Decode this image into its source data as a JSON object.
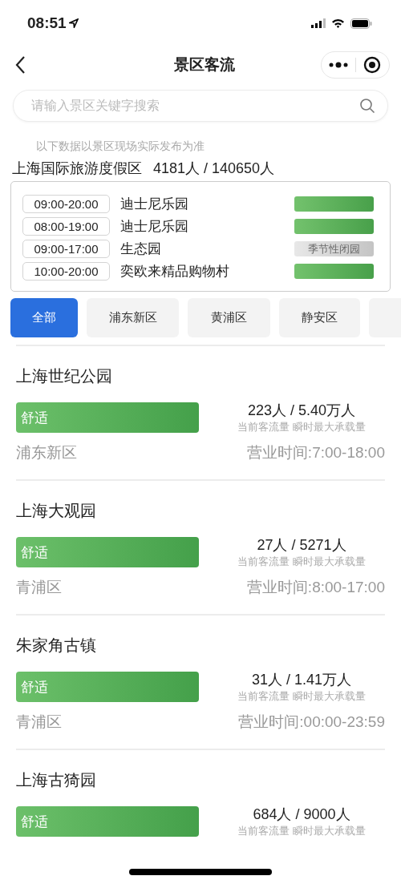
{
  "status_bar": {
    "time": "08:51"
  },
  "nav": {
    "title": "景区客流"
  },
  "search": {
    "placeholder": "请输入景区关键字搜索"
  },
  "notice": "以下数据以景区现场实际发布为准",
  "resort": {
    "name": "上海国际旅游度假区",
    "count": "4181人 / 140650人",
    "venues": [
      {
        "hours": "09:00-20:00",
        "name": "迪士尼乐园",
        "kind": "open"
      },
      {
        "hours": "08:00-19:00",
        "name": "迪士尼乐园",
        "kind": "open"
      },
      {
        "hours": "09:00-17:00",
        "name": "生态园",
        "kind": "closed",
        "status": "季节性闭园"
      },
      {
        "hours": "10:00-20:00",
        "name": "奕欧来精品购物村",
        "kind": "open"
      }
    ]
  },
  "tabs": [
    {
      "label": "全部",
      "selected": true
    },
    {
      "label": "浦东新区",
      "selected": false
    },
    {
      "label": "黄浦区",
      "selected": false
    },
    {
      "label": "静安区",
      "selected": false
    }
  ],
  "spots": [
    {
      "name": "上海世纪公园",
      "status": "舒适",
      "kind": "comfort",
      "count": "223人 / 5.40万人",
      "caption": "当前客流量 瞬时最大承载量",
      "district": "浦东新区",
      "hours": "营业时间:7:00-18:00"
    },
    {
      "name": "上海大观园",
      "status": "舒适",
      "kind": "comfort",
      "count": "27人 / 5271人",
      "caption": "当前客流量 瞬时最大承载量",
      "district": "青浦区",
      "hours": "营业时间:8:00-17:00"
    },
    {
      "name": "朱家角古镇",
      "status": "舒适",
      "kind": "comfort",
      "count": "31人 / 1.41万人",
      "caption": "当前客流量 瞬时最大承载量",
      "district": "青浦区",
      "hours": "营业时间:00:00-23:59"
    },
    {
      "name": "上海古猗园",
      "status": "舒适",
      "kind": "comfort",
      "count": "684人 / 9000人",
      "caption": "当前客流量 瞬时最大承载量"
    }
  ]
}
